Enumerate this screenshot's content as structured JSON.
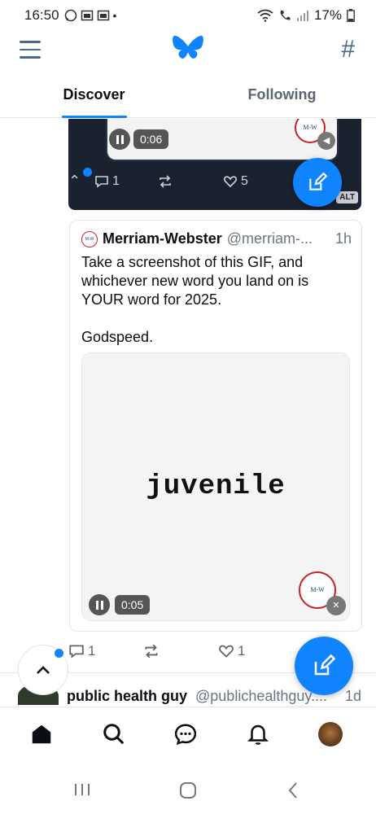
{
  "status_bar": {
    "time": "16:50",
    "left_icons": [
      "whatsapp-icon",
      "gallery-icon",
      "gallery-icon",
      "dot"
    ],
    "battery": "17%"
  },
  "header": {
    "logo": "butterfly-logo-icon",
    "menu_icon": "hamburger-icon",
    "feeds_icon": "hash-icon"
  },
  "tabs": [
    {
      "label": "Discover",
      "active": true
    },
    {
      "label": "Following",
      "active": false
    }
  ],
  "previous_post": {
    "video_time": "0:06",
    "reply_count": "1",
    "like_count": "5",
    "alt_badge": "ALT"
  },
  "quote_post": {
    "author_name": "Merriam-Webster",
    "handle": "@merriam-...",
    "time": "1h",
    "avatar_text": "Merriam-Webster",
    "text_lines": [
      "Take a screenshot of this GIF, and whichever new word you land on is YOUR word for 2025.",
      "Godspeed."
    ],
    "gif_word": "juvenile",
    "gif_time": "0:05",
    "badge_text": "Merriam-Webster"
  },
  "post_actions": {
    "reply_count": "1",
    "like_count": "1"
  },
  "next_post": {
    "author_name": "public health guy",
    "handle": "@publichealthguy....",
    "time": "1d"
  },
  "bottom_nav": [
    "home-icon",
    "search-icon",
    "chat-icon",
    "bell-icon",
    "profile-avatar"
  ],
  "colors": {
    "accent": "#1083fe",
    "muted_icon": "#4a6a8a",
    "dark_card": "#1a2230"
  }
}
